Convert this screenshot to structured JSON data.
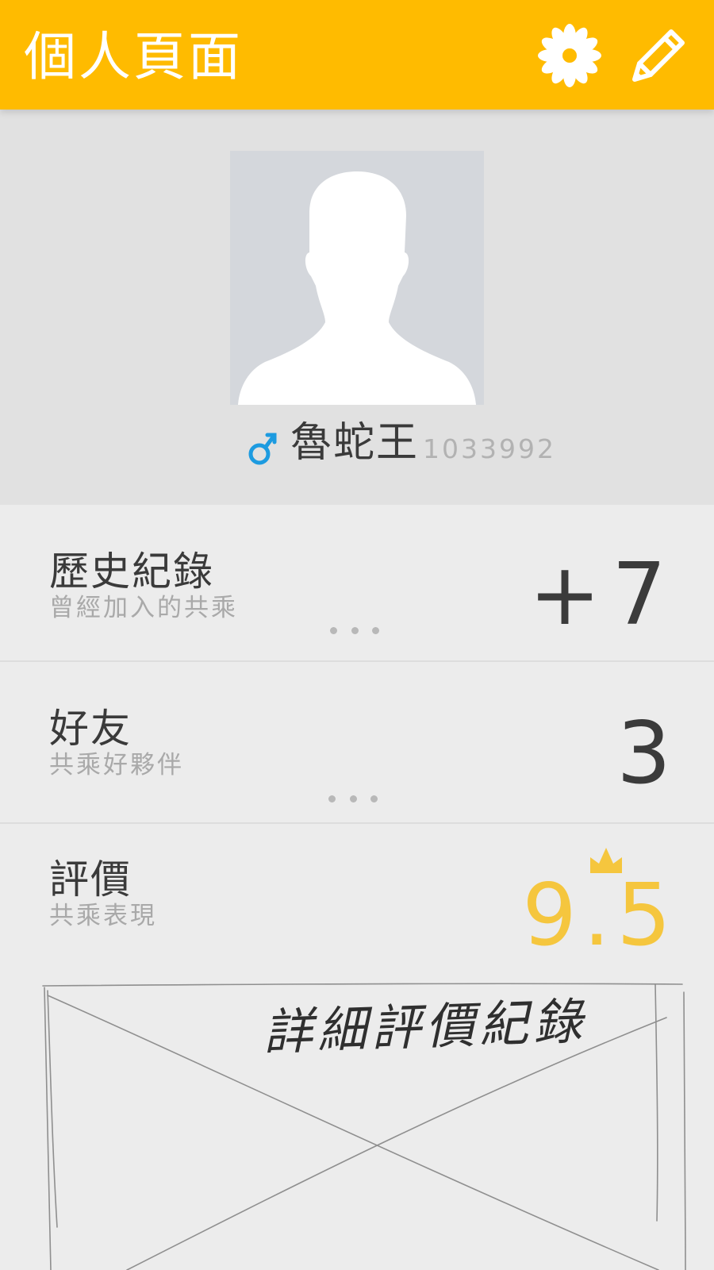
{
  "app_bar": {
    "title": "個人頁面",
    "settings_icon": "gear-flower-icon",
    "edit_icon": "pencil-icon",
    "background": "#ffbb00"
  },
  "profile": {
    "avatar_icon": "default-avatar-silhouette",
    "gender_icon": "male-symbol-icon",
    "gender_color": "#1d9be0",
    "name": "魯蛇王",
    "id": "1033992"
  },
  "stats": {
    "history": {
      "title": "歷史紀錄",
      "subtitle": "曾經加入的共乘",
      "value": "+7",
      "more_icon": "more-dots-icon"
    },
    "friends": {
      "title": "好友",
      "subtitle": "共乘好夥伴",
      "value": "3",
      "more_icon": "more-dots-icon"
    },
    "rating": {
      "title": "評價",
      "subtitle": "共乘表現",
      "value": "9.5",
      "value_color": "#f5c63e",
      "badge_icon": "crown-icon"
    }
  },
  "sketch": {
    "caption": "詳細評價紀錄",
    "placeholder_icon": "crossed-box-placeholder"
  }
}
